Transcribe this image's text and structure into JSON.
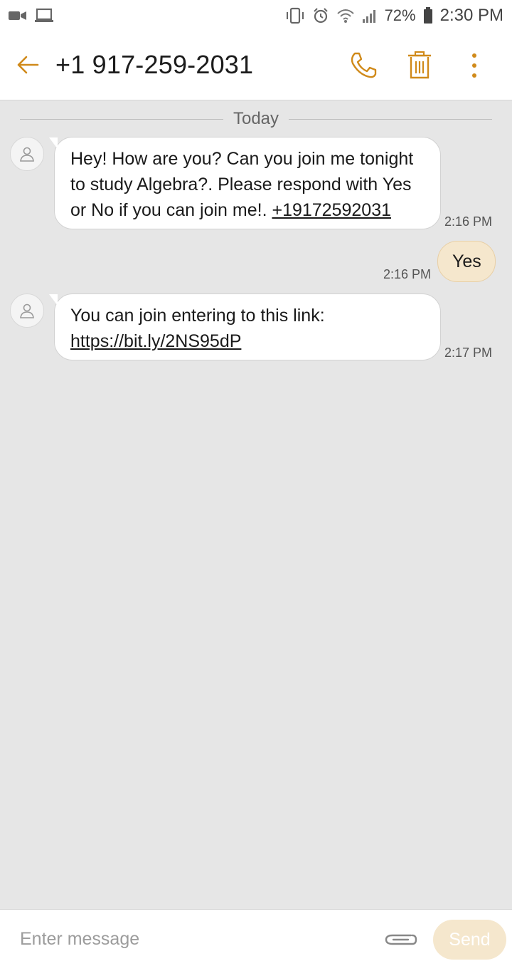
{
  "status_bar": {
    "battery": "72%",
    "time": "2:30 PM",
    "icons_left": [
      "video-call-icon",
      "laptop-icon"
    ],
    "icons_right": [
      "vibrate-icon",
      "alarm-icon",
      "wifi-icon",
      "signal-icon",
      "battery-icon"
    ]
  },
  "header": {
    "title": "+1 917-259-2031",
    "actions": [
      "call-icon",
      "delete-icon",
      "more-icon"
    ],
    "accent_color": "#d08a1a"
  },
  "conversation": {
    "date_label": "Today",
    "messages": [
      {
        "direction": "incoming",
        "text": "Hey! How are you? Can you join me tonight to study Algebra?. Please respond with Yes or No if you can join me!. ",
        "link": "+19172592031",
        "time": "2:16 PM"
      },
      {
        "direction": "outgoing",
        "text": "Yes",
        "time": "2:16 PM"
      },
      {
        "direction": "incoming",
        "text": "You can join entering to this link:",
        "link": "https://bit.ly/2NS95dP",
        "time": "2:17 PM"
      }
    ]
  },
  "composer": {
    "placeholder": "Enter message",
    "send_label": "Send"
  }
}
